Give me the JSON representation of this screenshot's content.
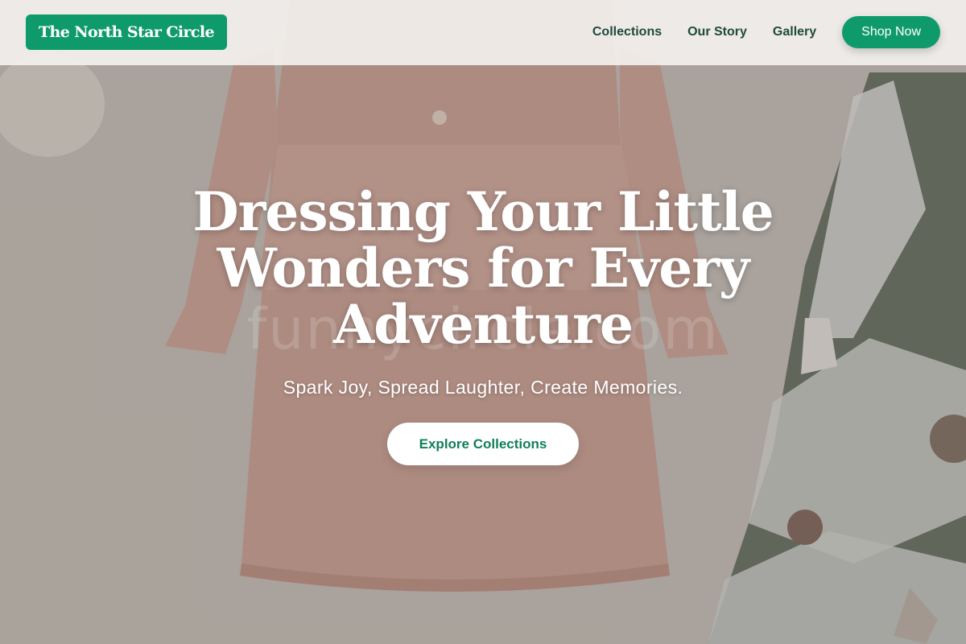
{
  "brand": {
    "name": "The North Star Circle",
    "color": "#0f9a6c"
  },
  "nav": {
    "links": [
      "Collections",
      "Our Story",
      "Gallery"
    ],
    "cta_label": "Shop Now"
  },
  "hero": {
    "title": "Dressing Your Little Wonders for Every Adventure",
    "subtitle": "Spark Joy, Spread Laughter, Create Memories.",
    "cta_label": "Explore Collections",
    "watermark": "funnycircle.com"
  },
  "colors": {
    "accent": "#0f9a6c",
    "nav_text": "#1f4a3c",
    "button_text": "#0f7f59"
  },
  "background_image": {
    "icons": [
      "dress-image",
      "christmas-tree-image",
      "ornament-image"
    ]
  }
}
